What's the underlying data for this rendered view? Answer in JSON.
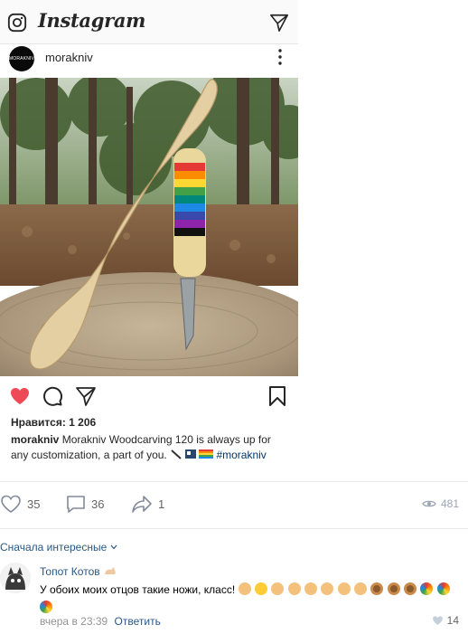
{
  "instagram": {
    "logo": "Instagram",
    "username": "morakniv",
    "avatar_text": "MORAKNIV",
    "likes": "Нравится: 1 206",
    "caption_user": "morakniv",
    "caption_text": "Morakniv Woodcarving 120 is always up for any customization, a part of you.",
    "caption_tag": "#morakniv",
    "liked": true,
    "heart_color": "#ed4956"
  },
  "post_stats": {
    "likes": "35",
    "comments": "36",
    "shares": "1",
    "views": "481"
  },
  "comments_section": {
    "sort_label": "Сначала интересные",
    "comment": {
      "author": "Топот Котов",
      "text": "У обоих моих отцов такие ножи, класс!",
      "time": "вчера в 23:39",
      "reply_label": "Ответить",
      "likes": "14"
    }
  },
  "colors": {
    "vk_link": "#2a5885",
    "vk_muted": "#656565",
    "ig_tag": "#00376b"
  }
}
